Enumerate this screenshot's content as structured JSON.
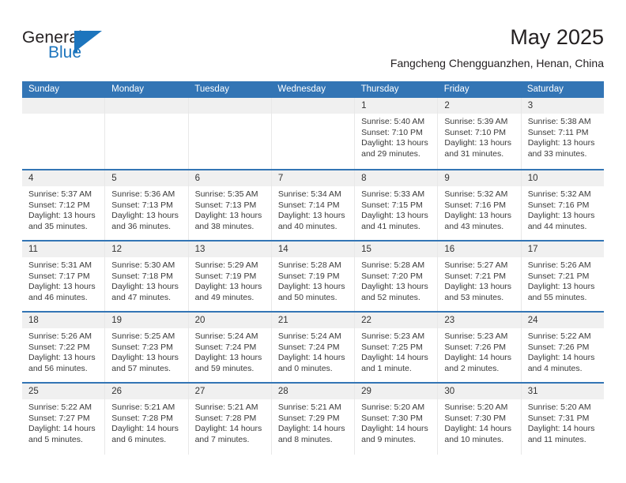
{
  "logo": {
    "word_one": "General",
    "word_two": "Blue",
    "mark": "triangle-flag-icon",
    "brand_color": "#1d75bd"
  },
  "header": {
    "month_title": "May 2025",
    "location": "Fangcheng Chengguanzhen, Henan, China"
  },
  "theme": {
    "header_blue": "#3375b5",
    "number_band_gray": "#f0f0f0",
    "text_color": "#3a3a3a"
  },
  "calendar": {
    "weekday_headers": [
      "Sunday",
      "Monday",
      "Tuesday",
      "Wednesday",
      "Thursday",
      "Friday",
      "Saturday"
    ],
    "weeks": [
      [
        {
          "day": "",
          "lines": []
        },
        {
          "day": "",
          "lines": []
        },
        {
          "day": "",
          "lines": []
        },
        {
          "day": "",
          "lines": []
        },
        {
          "day": "1",
          "lines": [
            "Sunrise: 5:40 AM",
            "Sunset: 7:10 PM",
            "Daylight: 13 hours",
            "and 29 minutes."
          ]
        },
        {
          "day": "2",
          "lines": [
            "Sunrise: 5:39 AM",
            "Sunset: 7:10 PM",
            "Daylight: 13 hours",
            "and 31 minutes."
          ]
        },
        {
          "day": "3",
          "lines": [
            "Sunrise: 5:38 AM",
            "Sunset: 7:11 PM",
            "Daylight: 13 hours",
            "and 33 minutes."
          ]
        }
      ],
      [
        {
          "day": "4",
          "lines": [
            "Sunrise: 5:37 AM",
            "Sunset: 7:12 PM",
            "Daylight: 13 hours",
            "and 35 minutes."
          ]
        },
        {
          "day": "5",
          "lines": [
            "Sunrise: 5:36 AM",
            "Sunset: 7:13 PM",
            "Daylight: 13 hours",
            "and 36 minutes."
          ]
        },
        {
          "day": "6",
          "lines": [
            "Sunrise: 5:35 AM",
            "Sunset: 7:13 PM",
            "Daylight: 13 hours",
            "and 38 minutes."
          ]
        },
        {
          "day": "7",
          "lines": [
            "Sunrise: 5:34 AM",
            "Sunset: 7:14 PM",
            "Daylight: 13 hours",
            "and 40 minutes."
          ]
        },
        {
          "day": "8",
          "lines": [
            "Sunrise: 5:33 AM",
            "Sunset: 7:15 PM",
            "Daylight: 13 hours",
            "and 41 minutes."
          ]
        },
        {
          "day": "9",
          "lines": [
            "Sunrise: 5:32 AM",
            "Sunset: 7:16 PM",
            "Daylight: 13 hours",
            "and 43 minutes."
          ]
        },
        {
          "day": "10",
          "lines": [
            "Sunrise: 5:32 AM",
            "Sunset: 7:16 PM",
            "Daylight: 13 hours",
            "and 44 minutes."
          ]
        }
      ],
      [
        {
          "day": "11",
          "lines": [
            "Sunrise: 5:31 AM",
            "Sunset: 7:17 PM",
            "Daylight: 13 hours",
            "and 46 minutes."
          ]
        },
        {
          "day": "12",
          "lines": [
            "Sunrise: 5:30 AM",
            "Sunset: 7:18 PM",
            "Daylight: 13 hours",
            "and 47 minutes."
          ]
        },
        {
          "day": "13",
          "lines": [
            "Sunrise: 5:29 AM",
            "Sunset: 7:19 PM",
            "Daylight: 13 hours",
            "and 49 minutes."
          ]
        },
        {
          "day": "14",
          "lines": [
            "Sunrise: 5:28 AM",
            "Sunset: 7:19 PM",
            "Daylight: 13 hours",
            "and 50 minutes."
          ]
        },
        {
          "day": "15",
          "lines": [
            "Sunrise: 5:28 AM",
            "Sunset: 7:20 PM",
            "Daylight: 13 hours",
            "and 52 minutes."
          ]
        },
        {
          "day": "16",
          "lines": [
            "Sunrise: 5:27 AM",
            "Sunset: 7:21 PM",
            "Daylight: 13 hours",
            "and 53 minutes."
          ]
        },
        {
          "day": "17",
          "lines": [
            "Sunrise: 5:26 AM",
            "Sunset: 7:21 PM",
            "Daylight: 13 hours",
            "and 55 minutes."
          ]
        }
      ],
      [
        {
          "day": "18",
          "lines": [
            "Sunrise: 5:26 AM",
            "Sunset: 7:22 PM",
            "Daylight: 13 hours",
            "and 56 minutes."
          ]
        },
        {
          "day": "19",
          "lines": [
            "Sunrise: 5:25 AM",
            "Sunset: 7:23 PM",
            "Daylight: 13 hours",
            "and 57 minutes."
          ]
        },
        {
          "day": "20",
          "lines": [
            "Sunrise: 5:24 AM",
            "Sunset: 7:24 PM",
            "Daylight: 13 hours",
            "and 59 minutes."
          ]
        },
        {
          "day": "21",
          "lines": [
            "Sunrise: 5:24 AM",
            "Sunset: 7:24 PM",
            "Daylight: 14 hours",
            "and 0 minutes."
          ]
        },
        {
          "day": "22",
          "lines": [
            "Sunrise: 5:23 AM",
            "Sunset: 7:25 PM",
            "Daylight: 14 hours",
            "and 1 minute."
          ]
        },
        {
          "day": "23",
          "lines": [
            "Sunrise: 5:23 AM",
            "Sunset: 7:26 PM",
            "Daylight: 14 hours",
            "and 2 minutes."
          ]
        },
        {
          "day": "24",
          "lines": [
            "Sunrise: 5:22 AM",
            "Sunset: 7:26 PM",
            "Daylight: 14 hours",
            "and 4 minutes."
          ]
        }
      ],
      [
        {
          "day": "25",
          "lines": [
            "Sunrise: 5:22 AM",
            "Sunset: 7:27 PM",
            "Daylight: 14 hours",
            "and 5 minutes."
          ]
        },
        {
          "day": "26",
          "lines": [
            "Sunrise: 5:21 AM",
            "Sunset: 7:28 PM",
            "Daylight: 14 hours",
            "and 6 minutes."
          ]
        },
        {
          "day": "27",
          "lines": [
            "Sunrise: 5:21 AM",
            "Sunset: 7:28 PM",
            "Daylight: 14 hours",
            "and 7 minutes."
          ]
        },
        {
          "day": "28",
          "lines": [
            "Sunrise: 5:21 AM",
            "Sunset: 7:29 PM",
            "Daylight: 14 hours",
            "and 8 minutes."
          ]
        },
        {
          "day": "29",
          "lines": [
            "Sunrise: 5:20 AM",
            "Sunset: 7:30 PM",
            "Daylight: 14 hours",
            "and 9 minutes."
          ]
        },
        {
          "day": "30",
          "lines": [
            "Sunrise: 5:20 AM",
            "Sunset: 7:30 PM",
            "Daylight: 14 hours",
            "and 10 minutes."
          ]
        },
        {
          "day": "31",
          "lines": [
            "Sunrise: 5:20 AM",
            "Sunset: 7:31 PM",
            "Daylight: 14 hours",
            "and 11 minutes."
          ]
        }
      ]
    ]
  }
}
